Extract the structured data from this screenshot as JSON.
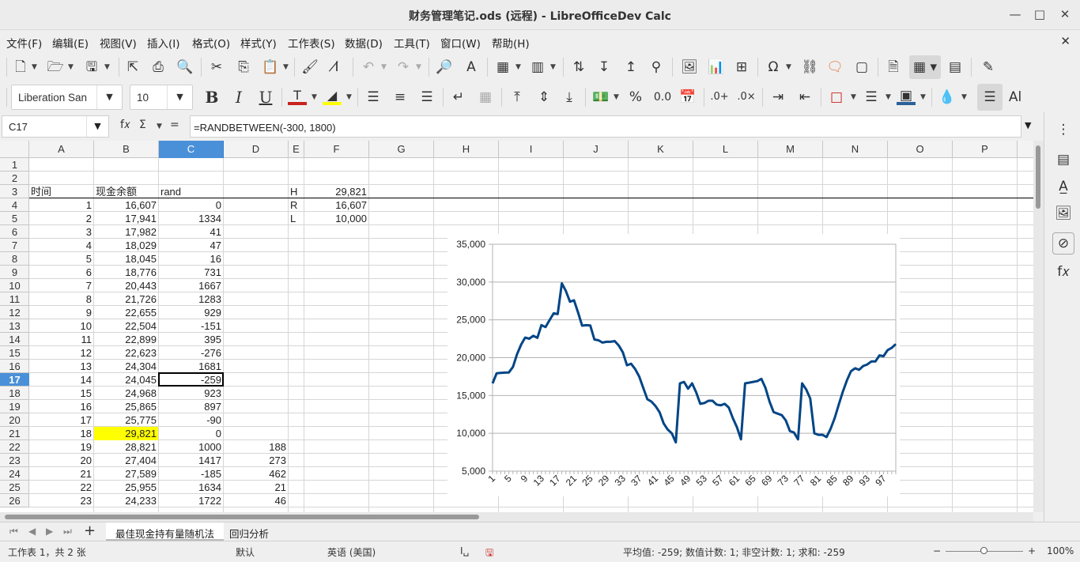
{
  "window": {
    "title": "财务管理笔记.ods (远程) - LibreOfficeDev Calc"
  },
  "menu": [
    "文件(F)",
    "编辑(E)",
    "视图(V)",
    "插入(I)",
    "格式(O)",
    "样式(Y)",
    "工作表(S)",
    "数据(D)",
    "工具(T)",
    "窗口(W)",
    "帮助(H)"
  ],
  "font": {
    "name": "Liberation San",
    "size": "10"
  },
  "formula_bar": {
    "cell_ref": "C17",
    "formula": "=RANDBETWEEN(-300, 1800)",
    "fx": "f𝑥",
    "sigma": "Σ",
    "eq": "="
  },
  "columns": [
    "A",
    "B",
    "C",
    "D",
    "E",
    "F",
    "G",
    "H",
    "I",
    "J",
    "K",
    "L",
    "M",
    "N",
    "O",
    "P"
  ],
  "rows": [
    "1",
    "2",
    "3",
    "4",
    "5",
    "6",
    "7",
    "8",
    "9",
    "10",
    "11",
    "12",
    "13",
    "14",
    "15",
    "16",
    "17",
    "18",
    "19",
    "20",
    "21",
    "22",
    "23",
    "24",
    "25",
    "26"
  ],
  "cells": {
    "A3": "时间",
    "B3": "现金余额",
    "C3": "rand",
    "E3": "H",
    "F3": "29,821",
    "E4": "R",
    "F4": "16,607",
    "E5": "L",
    "F5": "10,000",
    "A4": "1",
    "B4": "16,607",
    "C4": "0",
    "A5": "2",
    "B5": "17,941",
    "C5": "1334",
    "A6": "3",
    "B6": "17,982",
    "C6": "41",
    "A7": "4",
    "B7": "18,029",
    "C7": "47",
    "A8": "5",
    "B8": "18,045",
    "C8": "16",
    "A9": "6",
    "B9": "18,776",
    "C9": "731",
    "A10": "7",
    "B10": "20,443",
    "C10": "1667",
    "A11": "8",
    "B11": "21,726",
    "C11": "1283",
    "A12": "9",
    "B12": "22,655",
    "C12": "929",
    "A13": "10",
    "B13": "22,504",
    "C13": "-151",
    "A14": "11",
    "B14": "22,899",
    "C14": "395",
    "A15": "12",
    "B15": "22,623",
    "C15": "-276",
    "A16": "13",
    "B16": "24,304",
    "C16": "1681",
    "A17": "14",
    "B17": "24,045",
    "C17": "-259",
    "A18": "15",
    "B18": "24,968",
    "C18": "923",
    "A19": "16",
    "B19": "25,865",
    "C19": "897",
    "A20": "17",
    "B20": "25,775",
    "C20": "-90",
    "A21": "18",
    "B21": "29,821",
    "C21": "0",
    "A22": "19",
    "B22": "28,821",
    "C22": "1000",
    "D22": "188",
    "A23": "20",
    "B23": "27,404",
    "C23": "1417",
    "D23": "273",
    "A24": "21",
    "B24": "27,589",
    "C24": "-185",
    "D24": "462",
    "A25": "22",
    "B25": "25,955",
    "C25": "1634",
    "D25": "21",
    "A26": "23",
    "B26": "24,233",
    "C26": "1722",
    "D26": "46"
  },
  "highlight_color": "#ffff00",
  "selection_color": "#4a90d9",
  "chart_data": {
    "type": "line",
    "title": "",
    "xlabel": "",
    "ylabel": "",
    "ylim": [
      5000,
      35000
    ],
    "y_ticks": [
      "5,000",
      "10,000",
      "15,000",
      "20,000",
      "25,000",
      "30,000",
      "35,000"
    ],
    "x_ticks": [
      "1",
      "5",
      "9",
      "13",
      "17",
      "21",
      "25",
      "29",
      "33",
      "37",
      "41",
      "45",
      "49",
      "53",
      "57",
      "61",
      "65",
      "69",
      "73",
      "77",
      "81",
      "85",
      "89",
      "93",
      "97"
    ],
    "line_color": "#004586",
    "grid": true,
    "series": [
      {
        "values": [
          16607,
          17941,
          17982,
          18029,
          18045,
          18776,
          20443,
          21726,
          22655,
          22504,
          22899,
          22623,
          24304,
          24045,
          24968,
          25865,
          25775,
          29821,
          28821,
          27404,
          27589,
          25955,
          24233,
          24300,
          24250,
          22400,
          22300,
          22000,
          22100,
          22100,
          22200,
          21600,
          20700,
          19000,
          19200,
          18500,
          17500,
          16000,
          14500,
          14200,
          13600,
          12800,
          11300,
          10500,
          10000,
          8800,
          16600,
          16800,
          15900,
          16600,
          15400,
          13900,
          14000,
          14300,
          14300,
          13800,
          13700,
          13900,
          13400,
          12000,
          10800,
          9200,
          16600,
          16700,
          16800,
          16900,
          17200,
          16000,
          14200,
          12800,
          12600,
          12400,
          11700,
          10300,
          10100,
          9200,
          16600,
          15800,
          14600,
          10000,
          9800,
          9800,
          9500,
          10600,
          12000,
          13800,
          15500,
          17000,
          18200,
          18600,
          18400,
          18900,
          19100,
          19500,
          19500,
          20300,
          20200,
          21000,
          21300,
          21800
        ]
      }
    ]
  },
  "sheet_tabs": [
    "最佳现金持有量随机法",
    "回归分析"
  ],
  "status": {
    "sheet": "工作表 1，共 2 张",
    "style": "默认",
    "lang": "英语 (美国)",
    "summary": "平均值: -259; 数值计数: 1; 非空计数: 1; 求和: -259",
    "zoom": "100%"
  }
}
